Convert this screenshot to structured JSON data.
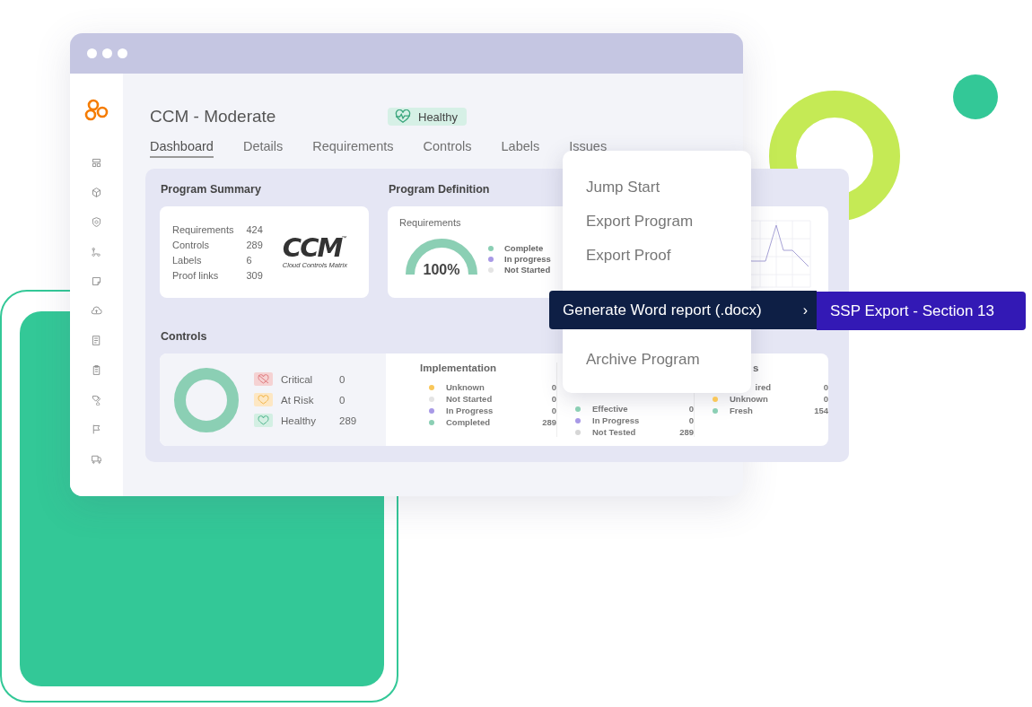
{
  "program": {
    "title": "CCM - Moderate",
    "status_badge": {
      "label": "Healthy",
      "kind": "healthy"
    }
  },
  "tabs": [
    {
      "label": "Dashboard",
      "selected": true
    },
    {
      "label": "Details",
      "selected": false
    },
    {
      "label": "Requirements",
      "selected": false
    },
    {
      "label": "Controls",
      "selected": false
    },
    {
      "label": "Labels",
      "selected": false
    },
    {
      "label": "Issues",
      "selected": false
    }
  ],
  "program_summary": {
    "heading": "Program Summary",
    "rows": [
      {
        "label": "Requirements",
        "value": "424"
      },
      {
        "label": "Controls",
        "value": "289"
      },
      {
        "label": "Labels",
        "value": "6"
      },
      {
        "label": "Proof links",
        "value": "309"
      }
    ],
    "logo": {
      "wordmark": "CCM",
      "trademark": "™",
      "tagline": "Cloud Controls Matrix"
    }
  },
  "program_definition": {
    "heading": "Program Definition",
    "card_title": "Requirements",
    "gauge": {
      "level": 1,
      "reading": "100%"
    },
    "legend": [
      {
        "label": "Complete",
        "color": "#8bcfb4"
      },
      {
        "label": "In progress",
        "color": "#a899e6"
      },
      {
        "label": "Not Started",
        "color": "#e4e4e4"
      }
    ]
  },
  "controls": {
    "heading": "Controls",
    "summary": [
      {
        "label": "Critical",
        "value": "0",
        "kind": "critical"
      },
      {
        "label": "At Risk",
        "value": "0",
        "kind": "risk"
      },
      {
        "label": "Healthy",
        "value": "289",
        "kind": "healthy"
      }
    ],
    "columns": [
      {
        "heading": "Implementation",
        "rows": [
          {
            "label": "Unknown",
            "value": "0",
            "color": "#f9c75a"
          },
          {
            "label": "Not Started",
            "value": "0",
            "color": "#e4e4e4"
          },
          {
            "label": "In Progress",
            "value": "0",
            "color": "#a899e6"
          },
          {
            "label": "Completed",
            "value": "289",
            "color": "#8bcfb4"
          }
        ]
      },
      {
        "rows": [
          {
            "label": "Effective",
            "value": "0",
            "color": "#8bcfb4"
          },
          {
            "label": "In Progress",
            "value": "0",
            "color": "#a899e6"
          },
          {
            "label": "Not Tested",
            "value": "289",
            "color": "#d6d6d6"
          }
        ]
      },
      {
        "heading": "s",
        "rows": [
          {
            "label": "ired",
            "value": "0",
            "clipped": true
          },
          {
            "label": "Unknown",
            "value": "0",
            "color": "#f9c75a"
          },
          {
            "label": "Fresh",
            "value": "154",
            "color": "#8bcfb4"
          }
        ]
      }
    ]
  },
  "menu": {
    "items": [
      {
        "label": "Jump Start",
        "kind": "item"
      },
      {
        "label": "Export Program",
        "kind": "item"
      },
      {
        "label": "Export Proof",
        "kind": "item"
      },
      {
        "label": "Generate Word report (.docx)",
        "kind": "submenu",
        "arrow": "›",
        "highlighted": true,
        "submenu": [
          "SSP Export - Section 13"
        ]
      },
      {
        "label": "Archive Program",
        "kind": "item"
      }
    ]
  }
}
